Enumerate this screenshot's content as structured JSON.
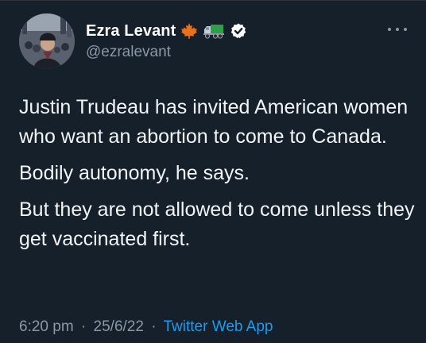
{
  "user": {
    "display_name": "Ezra Levant",
    "handle": "@ezralevant",
    "badges": [
      "maple-leaf-icon",
      "truck-icon",
      "verified-icon"
    ]
  },
  "tweet": {
    "paragraphs": [
      "Justin Trudeau has invited American women who want an abortion to come to Canada.",
      "Bodily autonomy, he says.",
      "But they are not allowed to come unless they get vaccinated first."
    ]
  },
  "meta": {
    "time": "6:20 pm",
    "separator": "·",
    "date": "25/6/22",
    "source": "Twitter Web App"
  },
  "colors": {
    "background": "#15202b",
    "text": "#ffffff",
    "muted": "#8b98a5",
    "link": "#1d9bf0",
    "maple_leaf": "#e8711c",
    "truck": "#2e9e4a",
    "verified_badge": "#ffffff"
  }
}
